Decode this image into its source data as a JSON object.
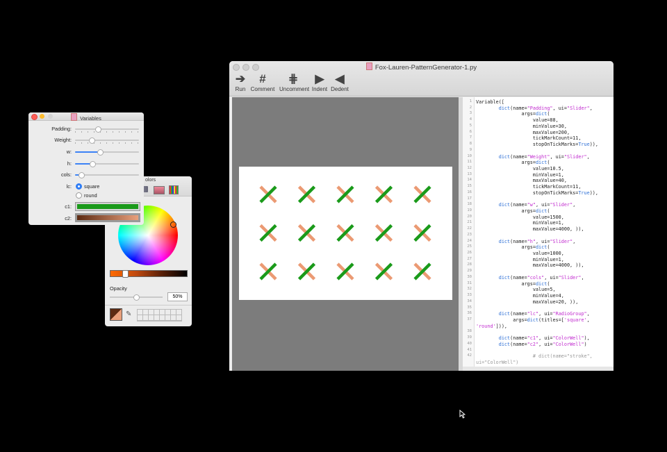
{
  "main_window": {
    "title": "Fox-Lauren-PatternGenerator-1.py",
    "toolbar": [
      {
        "label": "Run",
        "icon": "run-arrow-icon",
        "glyph": "➔"
      },
      {
        "label": "Comment",
        "icon": "hash-icon",
        "glyph": "#"
      },
      {
        "label": "Uncomment",
        "icon": "uncomment-icon",
        "glyph": "⋕"
      },
      {
        "label": "Indent",
        "icon": "indent-icon",
        "glyph": "▶"
      },
      {
        "label": "Dedent",
        "icon": "dedent-icon",
        "glyph": "◀"
      }
    ],
    "pattern": {
      "cols": 5,
      "rows": 3,
      "c1": "#1a9a1a",
      "c2": "#eb9a73"
    }
  },
  "editor": {
    "lines": [
      {
        "n": "1",
        "code": "Variable(["
      },
      {
        "n": "2",
        "code": "        dict(name=\"Padding\", ui=\"Slider\","
      },
      {
        "n": "3",
        "code": "                args=dict("
      },
      {
        "n": "4",
        "code": "                    value=88,"
      },
      {
        "n": "5",
        "code": "                    minValue=30,"
      },
      {
        "n": "6",
        "code": "                    maxValue=200,"
      },
      {
        "n": "7",
        "code": "                    tickMarkCount=11,"
      },
      {
        "n": "8",
        "code": "                    stopOnTickMarks=True)),"
      },
      {
        "n": "9",
        "code": ""
      },
      {
        "n": "10",
        "code": "        dict(name=\"Weight\", ui=\"Slider\","
      },
      {
        "n": "11",
        "code": "                args=dict("
      },
      {
        "n": "12",
        "code": "                    value=10.5,"
      },
      {
        "n": "13",
        "code": "                    minValue=1,"
      },
      {
        "n": "14",
        "code": "                    maxValue=40,"
      },
      {
        "n": "15",
        "code": "                    tickMarkCount=11,"
      },
      {
        "n": "16",
        "code": "                    stopOnTickMarks=True)),"
      },
      {
        "n": "17",
        "code": ""
      },
      {
        "n": "18",
        "code": "        dict(name=\"w\", ui=\"Slider\","
      },
      {
        "n": "19",
        "code": "                args=dict("
      },
      {
        "n": "20",
        "code": "                    value=1500,"
      },
      {
        "n": "21",
        "code": "                    minValue=1,"
      },
      {
        "n": "22",
        "code": "                    maxValue=4000, )),"
      },
      {
        "n": "23",
        "code": ""
      },
      {
        "n": "24",
        "code": "        dict(name=\"h\", ui=\"Slider\","
      },
      {
        "n": "25",
        "code": "                args=dict("
      },
      {
        "n": "26",
        "code": "                    value=1000,"
      },
      {
        "n": "27",
        "code": "                    minValue=1,"
      },
      {
        "n": "28",
        "code": "                    maxValue=4000, )),"
      },
      {
        "n": "29",
        "code": ""
      },
      {
        "n": "30",
        "code": "        dict(name=\"cols\", ui=\"Slider\","
      },
      {
        "n": "31",
        "code": "                args=dict("
      },
      {
        "n": "32",
        "code": "                    value=5,"
      },
      {
        "n": "33",
        "code": "                    minValue=4,"
      },
      {
        "n": "34",
        "code": "                    maxValue=20, )),"
      },
      {
        "n": "35",
        "code": ""
      },
      {
        "n": "36",
        "code": "        dict(name=\"lc\", ui=\"RadioGroup\","
      },
      {
        "n": "37",
        "code": "             args=dict(titles=['square',"
      },
      {
        "n": "",
        "code": "'round'])),"
      },
      {
        "n": "38",
        "code": ""
      },
      {
        "n": "39",
        "code": "        dict(name=\"c1\", ui=\"ColorWell\"),"
      },
      {
        "n": "40",
        "code": "        dict(name=\"c2\", ui=\"ColorWell\")"
      },
      {
        "n": "41",
        "code": ""
      },
      {
        "n": "42",
        "code": "                    # dict(name=\"stroke\","
      },
      {
        "n": "",
        "code": "ui=\"ColorWell\")"
      }
    ]
  },
  "variables_window": {
    "title": "Variables",
    "sliders": [
      {
        "label": "Padding:",
        "value": 88,
        "min": 30,
        "max": 200,
        "ticks": true
      },
      {
        "label": "Weight:",
        "value": 10.5,
        "min": 1,
        "max": 40,
        "ticks": true
      },
      {
        "label": "w:",
        "value": 1500,
        "min": 1,
        "max": 4000,
        "ticks": false
      },
      {
        "label": "h:",
        "value": 1000,
        "min": 1,
        "max": 4000,
        "ticks": false
      },
      {
        "label": "cols:",
        "value": 5,
        "min": 4,
        "max": 20,
        "ticks": false
      }
    ],
    "lc_label": "lc:",
    "lc_options": [
      "square",
      "round"
    ],
    "lc_selected": "square",
    "c1_label": "c1:",
    "c2_label": "c2:",
    "c1_color": "#1a9a1a",
    "c2_color": "#e9a07c"
  },
  "colors_panel": {
    "title_fragment": "olors",
    "opacity_label": "Opacity",
    "opacity_value": "50%",
    "opacity_fraction": 0.5,
    "hue_bar_position": 0.15,
    "current_color": "#5c2a12"
  }
}
